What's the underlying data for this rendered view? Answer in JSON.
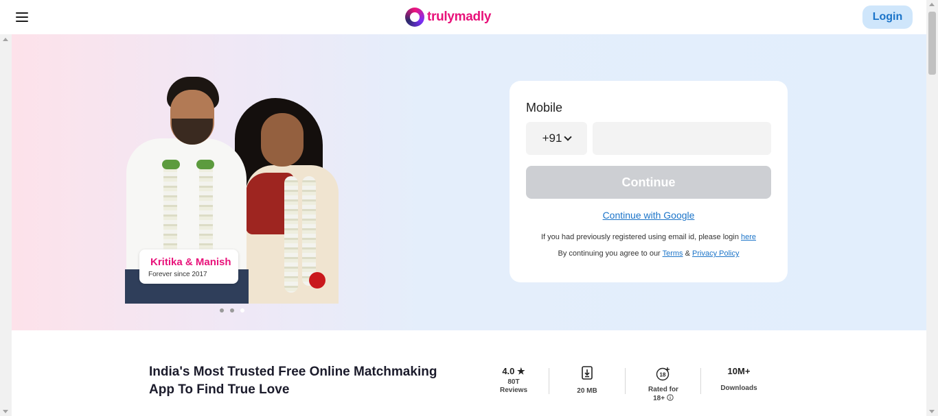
{
  "header": {
    "logo_text": "trulymadly",
    "login_label": "Login"
  },
  "hero": {
    "couple_name": "Kritika & Manish",
    "couple_since": "Forever since 2017",
    "carousel_dots": 3,
    "carousel_active_index": 2
  },
  "login_card": {
    "mobile_label": "Mobile",
    "country_code": "+91",
    "phone_value": "",
    "continue_label": "Continue",
    "google_label": "Continue with Google",
    "prev_registered_text": "If you had previously registered using email id, please login",
    "here_link": "here",
    "agree_text": "By continuing you agree to our",
    "terms_link": "Terms",
    "amp": "&",
    "privacy_link": "Privacy Policy"
  },
  "info": {
    "tagline": "India's Most Trusted Free Online Matchmaking App To Find True Love",
    "stats": [
      {
        "big": "4.0",
        "icon": "star-icon",
        "small": "80T\nReviews"
      },
      {
        "big": "",
        "icon": "download-file-icon",
        "small": "20 MB"
      },
      {
        "big": "",
        "icon": "age-18-plus-icon",
        "small": "Rated for\n18+"
      },
      {
        "big": "10M+",
        "icon": "",
        "small": "Downloads"
      }
    ],
    "rating_star": "★",
    "rating_reviews_count": "80T",
    "rating_reviews_label": "Reviews",
    "rated_line1": "Rated for",
    "rated_line2": "18+"
  },
  "colors": {
    "brand_pink": "#e8127a",
    "link_blue": "#1a73c8",
    "login_bg": "#cfe6fb",
    "disabled_btn": "#cdcfd3"
  }
}
